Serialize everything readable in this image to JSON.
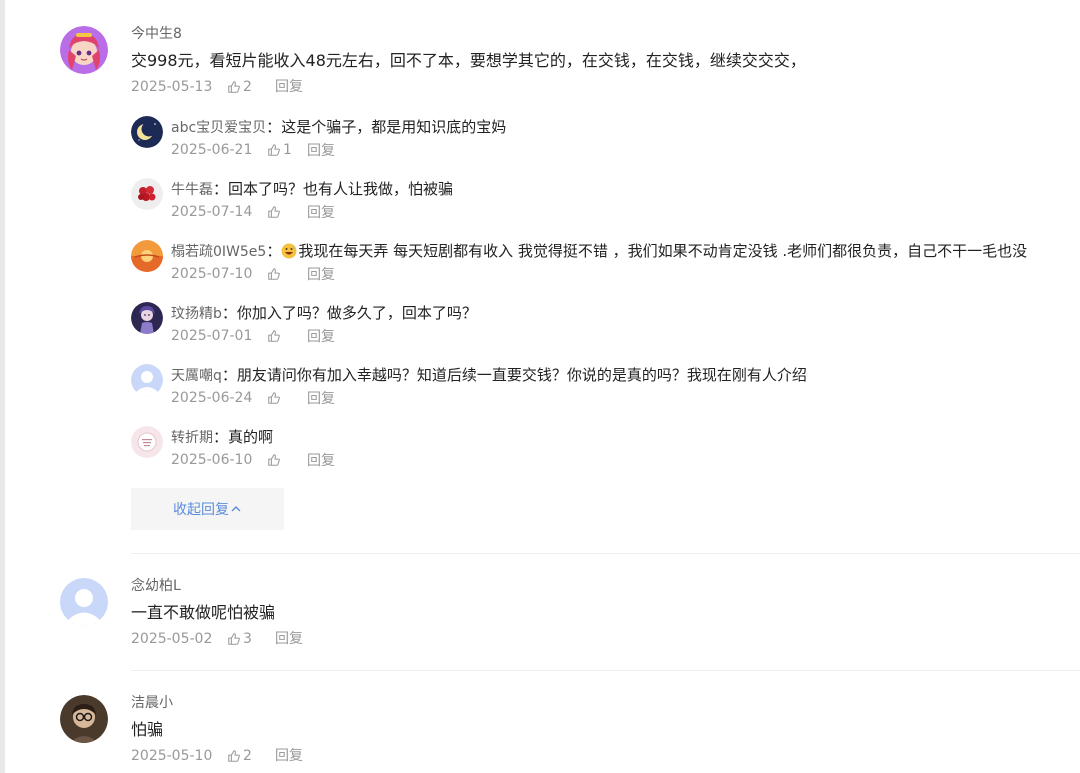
{
  "comments": [
    {
      "username": "今中生8",
      "text": "交998元，看短片能收入48元左右，回不了本，要想学其它的，在交钱，在交钱，继续交交交，",
      "date": "2025-05-13",
      "likes": "2",
      "reply_label": "回复",
      "avatar_icon": "anime-girl-avatar",
      "replies": [
        {
          "username": "abc宝贝爱宝贝",
          "sep": "：",
          "text": "这是个骗子，都是用知识底的宝妈",
          "date": "2025-06-21",
          "likes": "1",
          "reply_label": "回复",
          "avatar_icon": "moon-avatar"
        },
        {
          "username": "牛牛磊",
          "sep": "：",
          "text": "回本了吗？也有人让我做，怕被骗",
          "date": "2025-07-14",
          "likes": "",
          "reply_label": "回复",
          "avatar_icon": "berries-avatar"
        },
        {
          "username": "榻若疏0IW5e5",
          "sep": "：",
          "emoji": "grinning-sweat-emoji",
          "text": "我现在每天弄 每天短剧都有收入 我觉得挺不错 ，我们如果不动肯定没钱 .老师们都很负责，自己不干一毛也没",
          "date": "2025-07-10",
          "likes": "",
          "reply_label": "回复",
          "avatar_icon": "sunset-avatar"
        },
        {
          "username": "玟扬精b",
          "sep": "：",
          "text": "你加入了吗？做多久了，回本了吗？",
          "date": "2025-07-01",
          "likes": "",
          "reply_label": "回复",
          "avatar_icon": "anime-character-avatar"
        },
        {
          "username": "天厲嘲q",
          "sep": "：",
          "text": "朋友请问你有加入幸越吗？知道后续一直要交钱？你说的是真的吗？我现在刚有人介绍",
          "date": "2025-06-24",
          "likes": "",
          "reply_label": "回复",
          "avatar_icon": "default-user-avatar"
        },
        {
          "username": "转折期",
          "sep": "：",
          "text": "真的啊",
          "date": "2025-06-10",
          "likes": "",
          "reply_label": "回复",
          "avatar_icon": "pink-badge-avatar"
        }
      ],
      "collapse_label": "收起回复"
    },
    {
      "username": "念幼柏L",
      "text": "一直不敢做呢怕被骗",
      "date": "2025-05-02",
      "likes": "3",
      "reply_label": "回复",
      "avatar_icon": "default-user-avatar"
    },
    {
      "username": "洁晨小",
      "text": "怕骗",
      "date": "2025-05-10",
      "likes": "2",
      "reply_label": "回复",
      "avatar_icon": "photo-person-avatar"
    }
  ],
  "colors": {
    "accent": "#5b8ddb",
    "meta_text": "#999999",
    "username": "#666666"
  }
}
